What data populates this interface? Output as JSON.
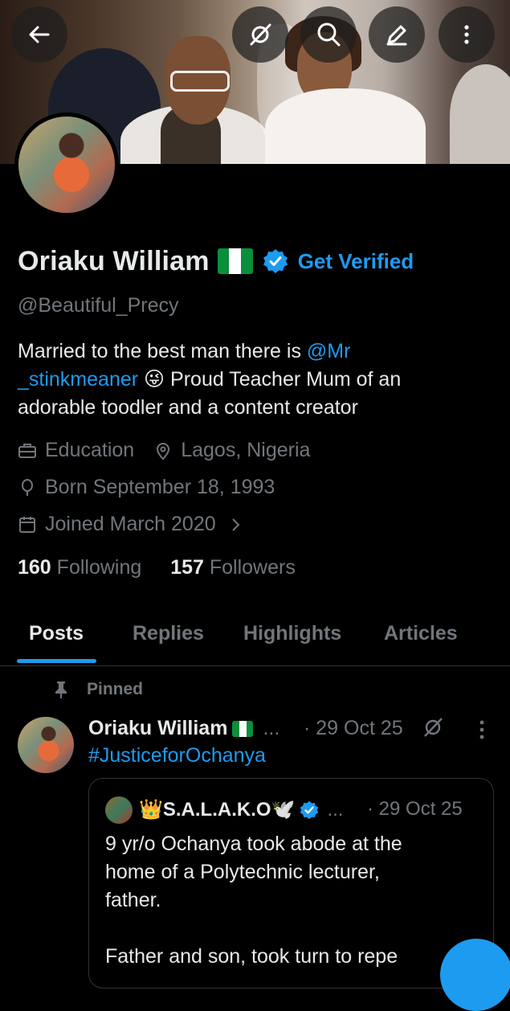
{
  "profile": {
    "name": "Oriaku William",
    "get_verified": "Get Verified",
    "handle": "@Beautiful_Precy",
    "bio_prefix": "Married to the best man there is ",
    "bio_mention_1": "@Mr",
    "bio_mention_2": "_stinkmeaner",
    "bio_emoji": " 😜 ",
    "bio_suffix_1": "Proud Teacher Mum of an",
    "bio_suffix_2": "adorable toodler and a content creator",
    "category": "Education",
    "location": "Lagos, Nigeria",
    "birthday": "Born September 18, 1993",
    "joined": "Joined March 2020",
    "following_count": "160",
    "following_label": "Following",
    "followers_count": "157",
    "followers_label": "Followers"
  },
  "tabs": [
    "Posts",
    "Replies",
    "Highlights",
    "Articles"
  ],
  "pinned_post": {
    "pinned_label": "Pinned",
    "author": "Oriaku William",
    "ellipsis": "...",
    "date": "· 29 Oct 25",
    "text": "#JusticeforOchanya",
    "quote": {
      "author": "👑S.A.L.A.K.O🕊️",
      "ellipsis": "...",
      "date": "· 29 Oct 25",
      "text": "9 yr/o Ochanya took abode at the\nhome of a  Polytechnic lecturer,\nfather.\n\nFather and son, took turn to repe"
    }
  },
  "colors": {
    "accent": "#1d9bf0",
    "background": "#000000",
    "muted": "#71767b"
  },
  "icons": [
    "back-arrow-icon",
    "grok-icon",
    "search-icon",
    "edit-icon",
    "more-vertical-icon",
    "verified-badge-icon",
    "briefcase-icon",
    "location-pin-icon",
    "balloon-icon",
    "calendar-icon",
    "chevron-right-icon",
    "pin-icon"
  ]
}
